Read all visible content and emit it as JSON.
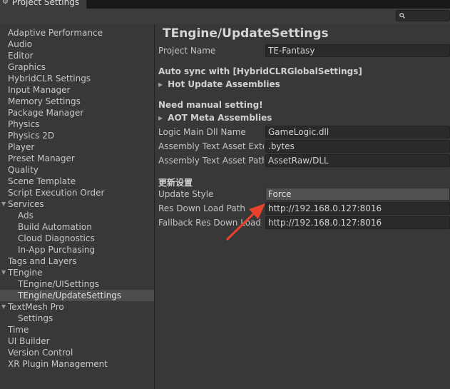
{
  "window": {
    "tab_title": "Project Settings",
    "tab_icon": "gear-icon"
  },
  "search": {
    "icon": "search-icon",
    "placeholder": ""
  },
  "sidebar": {
    "items": [
      {
        "label": "Adaptive Performance"
      },
      {
        "label": "Audio"
      },
      {
        "label": "Editor"
      },
      {
        "label": "Graphics"
      },
      {
        "label": "HybridCLR Settings"
      },
      {
        "label": "Input Manager"
      },
      {
        "label": "Memory Settings"
      },
      {
        "label": "Package Manager"
      },
      {
        "label": "Physics"
      },
      {
        "label": "Physics 2D"
      },
      {
        "label": "Player"
      },
      {
        "label": "Preset Manager"
      },
      {
        "label": "Quality"
      },
      {
        "label": "Scene Template"
      },
      {
        "label": "Script Execution Order"
      },
      {
        "label": "Services",
        "expanded": true
      },
      {
        "label": "Ads"
      },
      {
        "label": "Build Automation"
      },
      {
        "label": "Cloud Diagnostics"
      },
      {
        "label": "In-App Purchasing"
      },
      {
        "label": "Tags and Layers"
      },
      {
        "label": "TEngine",
        "expanded": true
      },
      {
        "label": "TEngine/UISettings"
      },
      {
        "label": "TEngine/UpdateSettings",
        "selected": true
      },
      {
        "label": "TextMesh Pro",
        "expanded": true
      },
      {
        "label": "Settings"
      },
      {
        "label": "Time"
      },
      {
        "label": "UI Builder"
      },
      {
        "label": "Version Control"
      },
      {
        "label": "XR Plugin Management"
      }
    ]
  },
  "main": {
    "title": "TEngine/UpdateSettings",
    "project_name": {
      "label": "Project Name",
      "value": "TE-Fantasy"
    },
    "auto_sync_header": "Auto sync with [HybridCLRGlobalSettings]",
    "hot_update_foldout": "Hot Update Assemblies",
    "manual_header": "Need manual setting!",
    "aot_foldout": "AOT Meta Assemblies",
    "logic_dll": {
      "label": "Logic Main Dll Name",
      "value": "GameLogic.dll"
    },
    "text_asset_ext": {
      "label": "Assembly Text Asset Exten",
      "value": ".bytes"
    },
    "text_asset_path": {
      "label": "Assembly Text Asset Path",
      "value": "AssetRaw/DLL"
    },
    "update_header": "更新设置",
    "update_style": {
      "label": "Update Style",
      "value": "Force"
    },
    "res_down_path": {
      "label": "Res Down Load Path",
      "value": "http://192.168.0.127:8016"
    },
    "fallback_path": {
      "label": "Fallback Res Down Load P",
      "value": "http://192.168.0.127:8016"
    }
  },
  "colors": {
    "panel_bg": "#383838",
    "field_bg": "#2a2a2a",
    "selected_bg": "#4d4d4d",
    "annotation_arrow": "#e8412c"
  }
}
